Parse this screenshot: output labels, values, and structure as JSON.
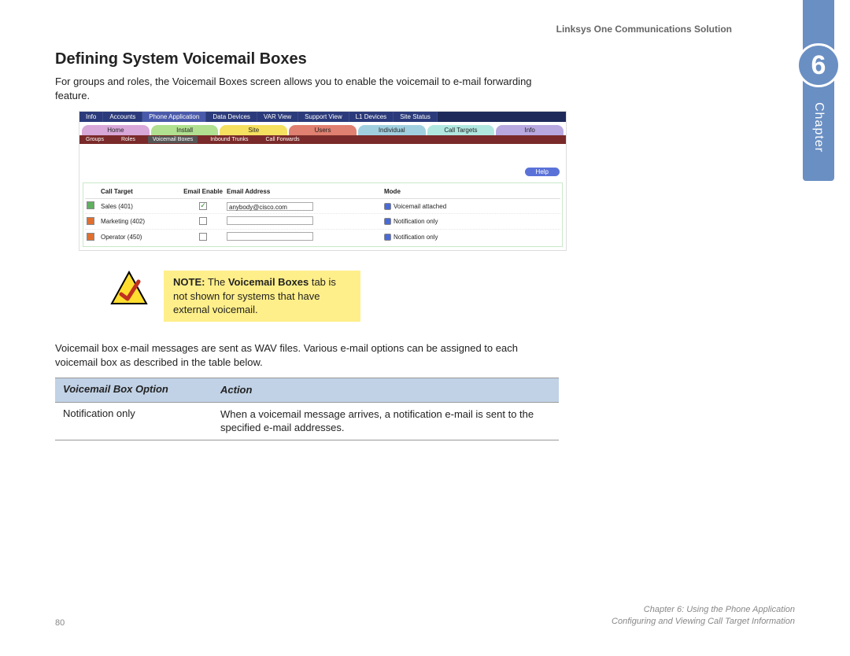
{
  "doc_header": "Linksys One Communications Solution",
  "chapter": {
    "number": "6",
    "label": "Chapter"
  },
  "section": {
    "title": "Defining System Voicemail Boxes",
    "intro": "For groups and roles, the Voicemail Boxes screen allows you to enable the voicemail to e-mail forwarding feature.",
    "mid_para": "Voicemail box e-mail messages are sent as WAV files. Various e-mail options can be assigned to each voicemail box as described in the table below."
  },
  "screenshot": {
    "top_tabs": [
      "Info",
      "Accounts",
      "Phone Application",
      "Data Devices",
      "VAR View",
      "Support View",
      "L1 Devices",
      "Site Status"
    ],
    "top_active": 2,
    "mid_tabs": [
      {
        "label": "Home",
        "color": "#d8a8d8"
      },
      {
        "label": "Install",
        "color": "#b0e090"
      },
      {
        "label": "Site",
        "color": "#f5e060"
      },
      {
        "label": "Users",
        "color": "#e08070"
      },
      {
        "label": "Individual",
        "color": "#a0d0e0"
      },
      {
        "label": "Call Targets",
        "color": "#b0e8e0"
      },
      {
        "label": "Info",
        "color": "#b8a8e0"
      }
    ],
    "sub_tabs": [
      "Groups",
      "Roles",
      "Voicemail Boxes",
      "Inbound Trunks",
      "Call Forwards"
    ],
    "sub_active": 2,
    "help": "Help",
    "columns": {
      "target": "Call Target",
      "enable": "Email Enable",
      "email": "Email Address",
      "mode": "Mode"
    },
    "rows": [
      {
        "target": "Sales (401)",
        "enable": true,
        "email": "anybody@cisco.com",
        "mode": "Voicemail attached"
      },
      {
        "target": "Marketing (402)",
        "enable": false,
        "email": "",
        "mode": "Notification only"
      },
      {
        "target": "Operator (450)",
        "enable": false,
        "email": "",
        "mode": "Notification only"
      }
    ]
  },
  "note": {
    "prefix": "NOTE:",
    "line1": " The ",
    "bold": "Voicemail Boxes",
    "line2": " tab is not shown for systems that have external voicemail."
  },
  "option_table": {
    "head1": "Voicemail Box Option",
    "head2": "Action",
    "row1": {
      "option": "Notification only",
      "action": "When a voicemail message arrives, a notification e-mail is sent to the specified e-mail addresses."
    }
  },
  "footer": {
    "page": "80",
    "line1": "Chapter 6: Using the Phone Application",
    "line2": "Configuring and Viewing Call Target Information"
  }
}
